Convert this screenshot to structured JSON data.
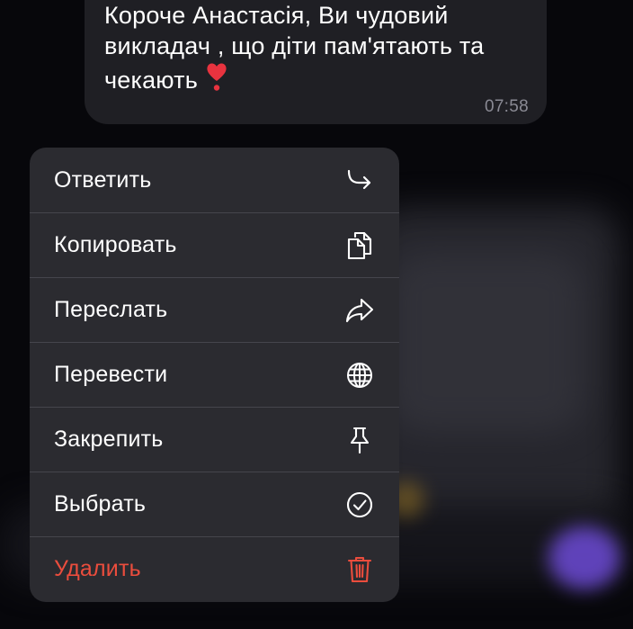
{
  "message": {
    "lines": [
      "Короче Анастасія, Ви чудовий",
      "викладач , що діти пам'ятають та",
      "чекають"
    ],
    "emoji": "heart-exclamation-emoji",
    "time": "07:58"
  },
  "menu": {
    "items": [
      {
        "label": "Ответить",
        "icon": "reply-icon"
      },
      {
        "label": "Копировать",
        "icon": "copy-icon"
      },
      {
        "label": "Переслать",
        "icon": "forward-icon"
      },
      {
        "label": "Перевести",
        "icon": "globe-icon"
      },
      {
        "label": "Закрепить",
        "icon": "pin-icon"
      },
      {
        "label": "Выбрать",
        "icon": "select-check-icon"
      },
      {
        "label": "Удалить",
        "icon": "trash-icon"
      }
    ]
  },
  "colors": {
    "menu_bg": "#2b2b30",
    "bubble_bg": "#1f1f24",
    "danger": "#eb4d3d",
    "time": "#8a8a94"
  }
}
